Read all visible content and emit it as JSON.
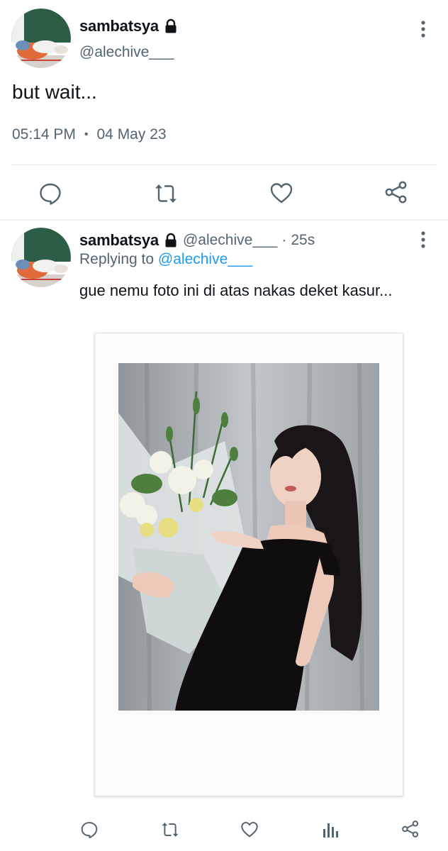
{
  "main_tweet": {
    "author_name": "sambatsya",
    "author_handle": "@alechive___",
    "text": "but wait...",
    "time": "05:14 PM",
    "separator": "•",
    "date": "04 May 23",
    "actions": [
      "reply-icon",
      "retweet-icon",
      "like-icon",
      "share-icon"
    ]
  },
  "reply_tweet": {
    "author_name": "sambatsya",
    "author_handle": "@alechive___",
    "separator": "·",
    "time_ago": "25s",
    "replying_label": "Replying to",
    "replying_handle": "@alechive___",
    "text": "gue nemu foto ini di atas nakas deket kasur...",
    "actions": [
      "reply-icon",
      "retweet-icon",
      "like-icon",
      "analytics-icon",
      "share-icon"
    ]
  },
  "colors": {
    "text_primary": "#0f1419",
    "text_secondary": "#536471",
    "link": "#1d9bf0",
    "divider": "#e3e7ea"
  }
}
